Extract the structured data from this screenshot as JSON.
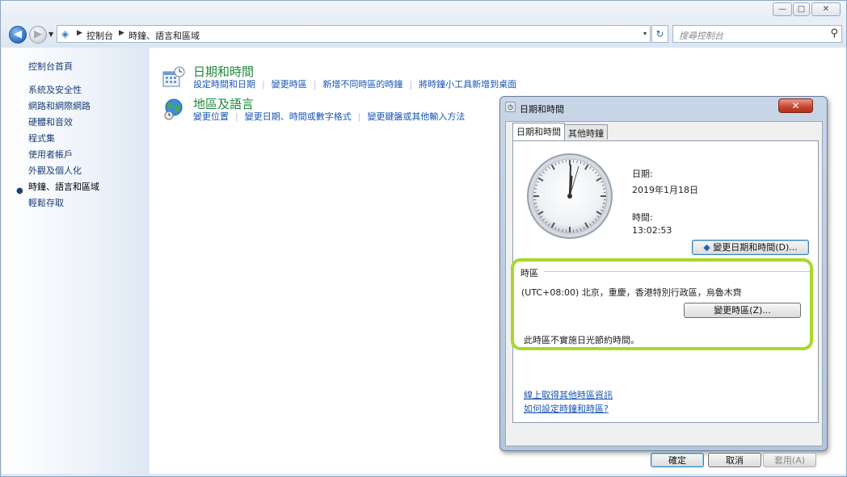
{
  "window": {
    "controls": {
      "minimize": "—",
      "maximize": "□",
      "close": "✕"
    }
  },
  "address_bar": {
    "crumbs": [
      "控制台",
      "時鐘、語言和區域"
    ],
    "dropdown": "▾",
    "refresh": "↻",
    "search_placeholder": "搜尋控制台"
  },
  "sidebar": {
    "home": "控制台首頁",
    "items": [
      "系統及安全性",
      "網路和網際網路",
      "硬體和音效",
      "程式集",
      "使用者帳戶",
      "外觀及個人化",
      "時鐘、語言和區域",
      "輕鬆存取"
    ],
    "active_index": 6
  },
  "categories": [
    {
      "title": "日期和時間",
      "links": [
        "設定時間和日期",
        "變更時區",
        "新增不同時區的時鐘",
        "將時鐘小工具新增到桌面"
      ]
    },
    {
      "title": "地區及語言",
      "links": [
        "變更位置",
        "變更日期、時間或數字格式",
        "變更鍵盤或其他輸入方法"
      ]
    }
  ],
  "dialog": {
    "title": "日期和時間",
    "close": "✕",
    "tabs": [
      "日期和時間",
      "其他時鐘"
    ],
    "date_label": "日期:",
    "date_value": "2019年1月18日",
    "time_label": "時間:",
    "time_value": "13:02:53",
    "change_datetime_button": "變更日期和時間(D)...",
    "timezone_header": "時區",
    "timezone_value": "(UTC+08:00) 北京，重慶，香港特別行政區，烏魯木齊",
    "change_timezone_button": "變更時區(Z)...",
    "dst_note": "此時區不實施日光節約時間。",
    "link_online": "線上取得其他時區資訊",
    "link_howto": "如何設定時鐘和時區?",
    "ok": "確定",
    "cancel": "取消",
    "apply": "套用(A)"
  },
  "colors": {
    "highlight": "#a8d82c",
    "link": "#1a56b6",
    "category_title": "#1d8a3d"
  }
}
